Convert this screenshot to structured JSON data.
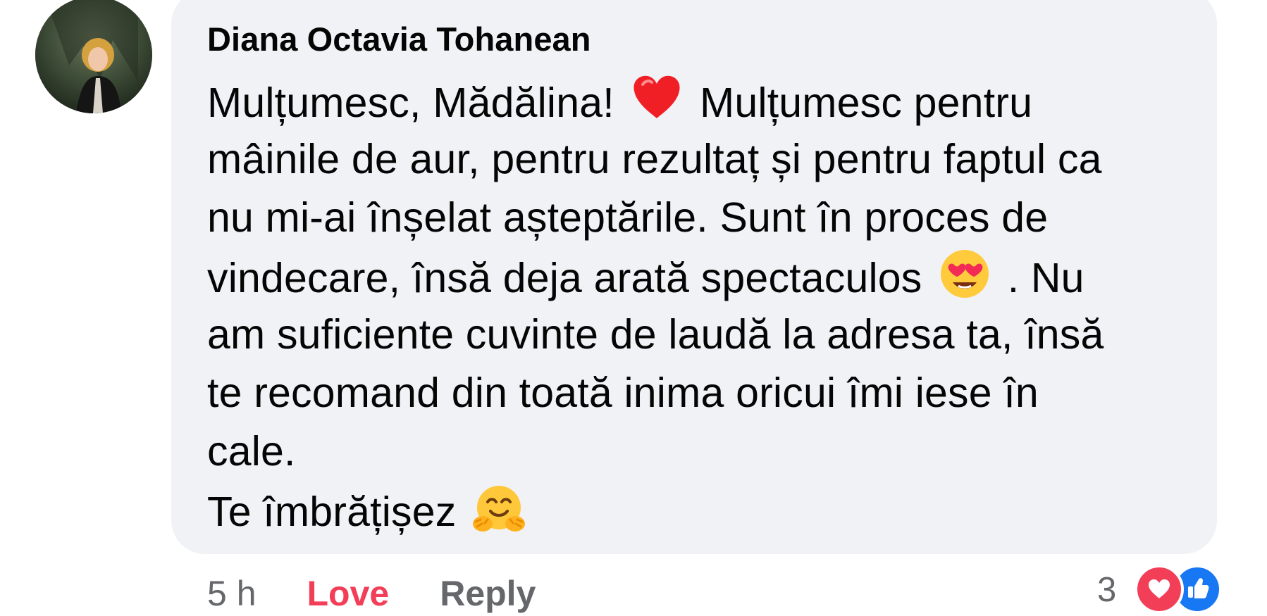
{
  "comment": {
    "author": "Diana Octavia Tohanean",
    "lines": {
      "l1a": "Mulțumesc, Mădălina!",
      "l1b": "Mulțumesc pentru",
      "l2": "mâinile de aur, pentru rezultaț și pentru faptul ca",
      "l3": "nu mi-ai înșelat așteptările. Sunt în proces de",
      "l4a": "vindecare, însă deja arată spectaculos",
      "l4b": ". Nu",
      "l5": "am suficiente cuvinte de laudă la adresa ta, însă",
      "l6": "te recomand din toată inima oricui îmi iese în",
      "l7": "cale.",
      "l8": "Te îmbrățișez"
    },
    "emojis": {
      "first": "red-heart-emoji",
      "second": "heart-eyes-emoji",
      "third": "hugging-face-emoji"
    }
  },
  "actions": {
    "time": "5 h",
    "love": "Love",
    "reply": "Reply"
  },
  "reactions": {
    "count": "3",
    "types": [
      "love-reaction-icon",
      "like-reaction-icon"
    ]
  },
  "colors": {
    "bubble": "#f0f2f5",
    "love": "#f33e58",
    "like": "#1877f2",
    "secondary_text": "#65676b"
  }
}
